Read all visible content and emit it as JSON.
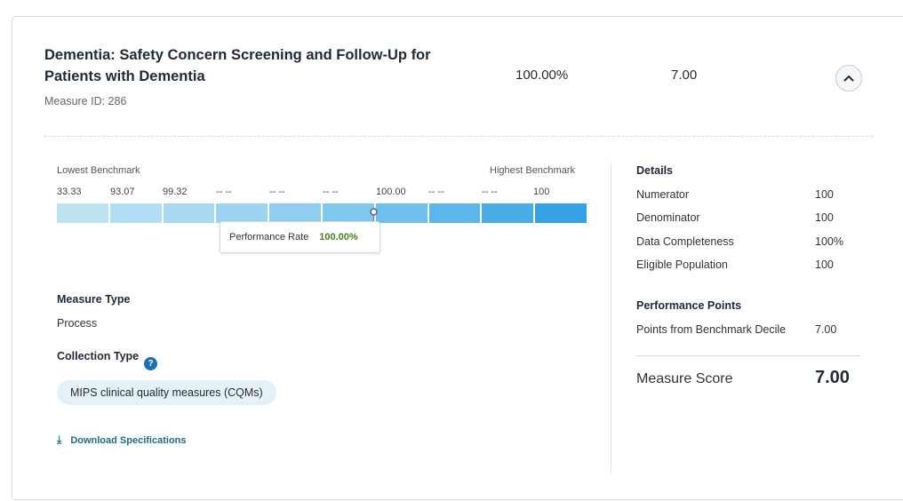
{
  "measure": {
    "title": "Dementia: Safety Concern Screening and Follow-Up for Patients with Dementia",
    "id_text": "Measure ID: 286",
    "performance_rate": "100.00%",
    "points": "7.00"
  },
  "benchmark": {
    "lowest_label": "Lowest Benchmark",
    "highest_label": "Highest Benchmark",
    "ticks": [
      "33.33",
      "93.07",
      "99.32",
      "-- --",
      "-- --",
      "-- --",
      "100.00",
      "-- --",
      "-- --",
      "100"
    ],
    "segment_colors": [
      "#bde3f3",
      "#b2def3",
      "#a7d9f2",
      "#9cd4f1",
      "#8fcef0",
      "#81c8ee",
      "#6fbfec",
      "#5db6ea",
      "#49ace7",
      "#35a2e4"
    ],
    "performance_fraction": 0.6,
    "tooltip_label": "Performance Rate",
    "tooltip_value": "100.00%"
  },
  "measure_type": {
    "heading": "Measure Type",
    "value": "Process"
  },
  "collection_type": {
    "heading": "Collection Type",
    "help_icon": "?",
    "value": "MIPS clinical quality measures (CQMs)"
  },
  "download": {
    "icon": "download-icon",
    "label": "Download Specifications"
  },
  "details": {
    "heading": "Details",
    "rows": [
      {
        "label": "Numerator",
        "value": "100"
      },
      {
        "label": "Denominator",
        "value": "100"
      },
      {
        "label": "Data Completeness",
        "value": "100%"
      },
      {
        "label": "Eligible Population",
        "value": "100"
      }
    ]
  },
  "performance_points": {
    "heading": "Performance Points",
    "label": "Points from Benchmark Decile",
    "value": "7.00"
  },
  "score": {
    "label": "Measure Score",
    "value": "7.00"
  }
}
